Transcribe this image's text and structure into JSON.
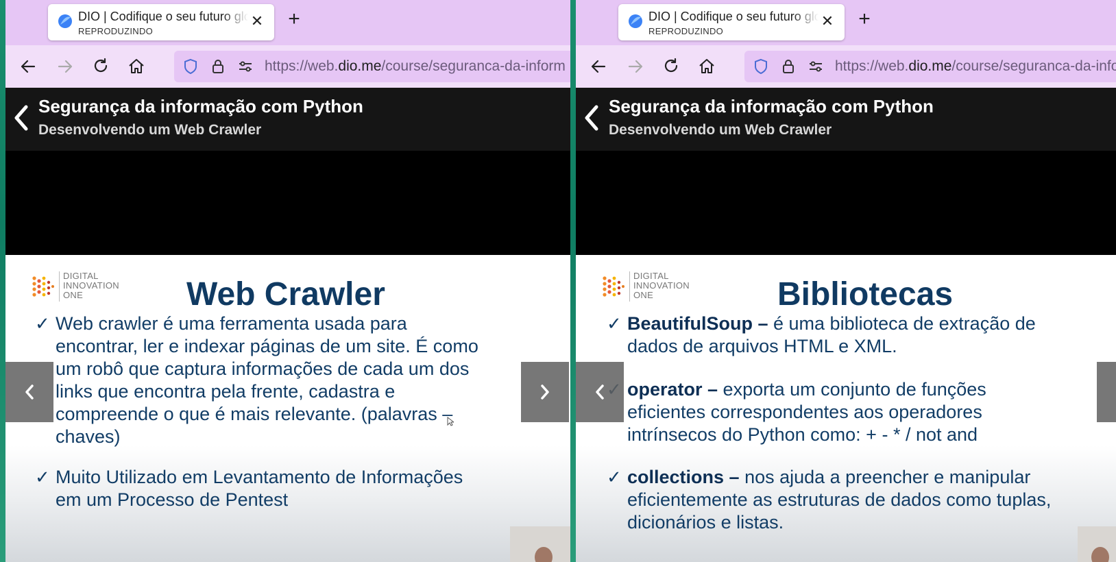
{
  "colors": {
    "tabbar": "#e6c6f5",
    "toolbar": "#f2dff9",
    "header": "#151515",
    "slide_title": "#103a62",
    "bullet_text": "#123d66"
  },
  "left": {
    "tab": {
      "title": "DIO | Codifique o seu futuro glo",
      "subtitle": "REPRODUZINDO",
      "favicon": "dio-logo-icon"
    },
    "url": {
      "prefix": "https://web.",
      "domain": "dio.me",
      "path": "/course/seguranca-da-inform"
    },
    "header": {
      "course_title": "Segurança da informação com Python",
      "lesson_title": "Desenvolvendo um Web Crawler"
    },
    "slide": {
      "logo_lines": [
        "DIGITAL",
        "INNOVATION",
        "ONE"
      ],
      "title": "Web Crawler",
      "bullets": [
        {
          "lines": [
            "Web crawler é uma ferramenta usada para",
            "encontrar, ler e indexar páginas de um site. É como",
            "um robô que captura informações de cada um dos",
            "links que encontra pela frente, cadastra e",
            "compreende o que é mais relevante. (palavras –",
            "chaves)"
          ]
        },
        {
          "lines": [
            "Muito Utilizado em Levantamento de Informações",
            "em um Processo de Pentest"
          ]
        }
      ]
    }
  },
  "right": {
    "tab": {
      "title": "DIO | Codifique o seu futuro glo",
      "subtitle": "REPRODUZINDO",
      "favicon": "dio-logo-icon"
    },
    "url": {
      "prefix": "https://web.",
      "domain": "dio.me",
      "path": "/course/seguranca-da-info"
    },
    "header": {
      "course_title": "Segurança da informação com Python",
      "lesson_title": "Desenvolvendo um Web Crawler"
    },
    "slide": {
      "logo_lines": [
        "DIGITAL",
        "INNOVATION",
        "ONE"
      ],
      "title": "Bibliotecas",
      "bullets": [
        {
          "bold": "BeautifulSoup –",
          "rest": " é uma biblioteca de extração de",
          "lines": [
            "dados de arquivos HTML e XML."
          ]
        },
        {
          "bold": "operator –",
          "rest": " exporta um conjunto de funções",
          "lines": [
            "eficientes correspondentes aos operadores",
            "intrínsecos do Python como: + - * / not and"
          ]
        },
        {
          "bold": "collections –",
          "rest": " nos ajuda a preencher e manipular",
          "lines": [
            "eficientemente as estruturas de dados como tuplas,",
            "dicionários e listas."
          ]
        }
      ]
    }
  }
}
